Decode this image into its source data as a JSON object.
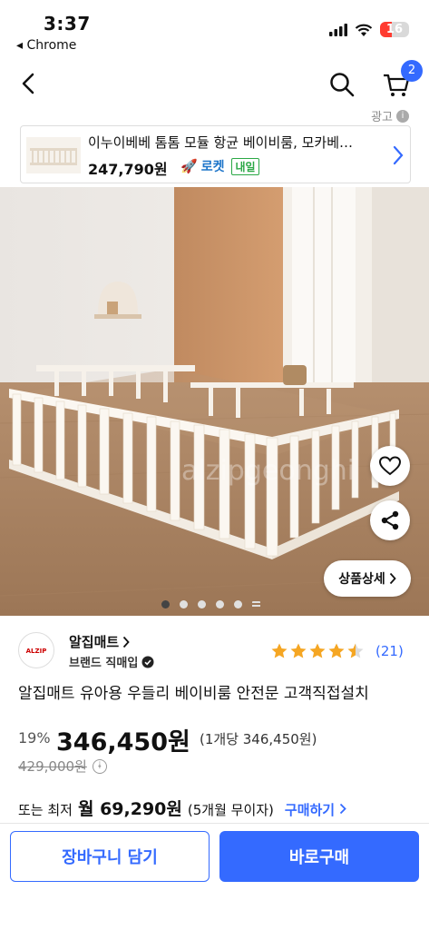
{
  "status_bar": {
    "time": "3:37",
    "back_app": "◂ Chrome",
    "battery": "16"
  },
  "header": {
    "cart_badge": "2"
  },
  "ad": {
    "label": "광고",
    "title": "이누이베베 톰톰 모듈 항균 베이비룸, 모카베…",
    "price": "247,790원",
    "rocket": "로켓",
    "delivery": "내일"
  },
  "gallery": {
    "watermark": "alzipgeonghi",
    "detail_button": "상품상세",
    "page_count": 5,
    "active_index": 0
  },
  "seller": {
    "name": "알집매트",
    "subtitle": "브랜드 직매입",
    "logo_text": "ALZIP mat",
    "rating": 4.5,
    "review_count": "(21)"
  },
  "product": {
    "title": "알집매트 유아용 우들리 베이비룸 안전문 고객직접설치",
    "discount": "19%",
    "price": "346,450원",
    "unit_price": "(1개당 346,450원)",
    "original_price": "429,000원",
    "installment_prefix": "또는 최저",
    "installment_amount": "월 69,290원",
    "installment_terms": "(5개월 무이자)",
    "installment_link": "구매하기"
  },
  "actions": {
    "add_to_cart": "장바구니 담기",
    "buy_now": "바로구매"
  },
  "colors": {
    "accent": "#346aff",
    "star": "#f5a623"
  }
}
